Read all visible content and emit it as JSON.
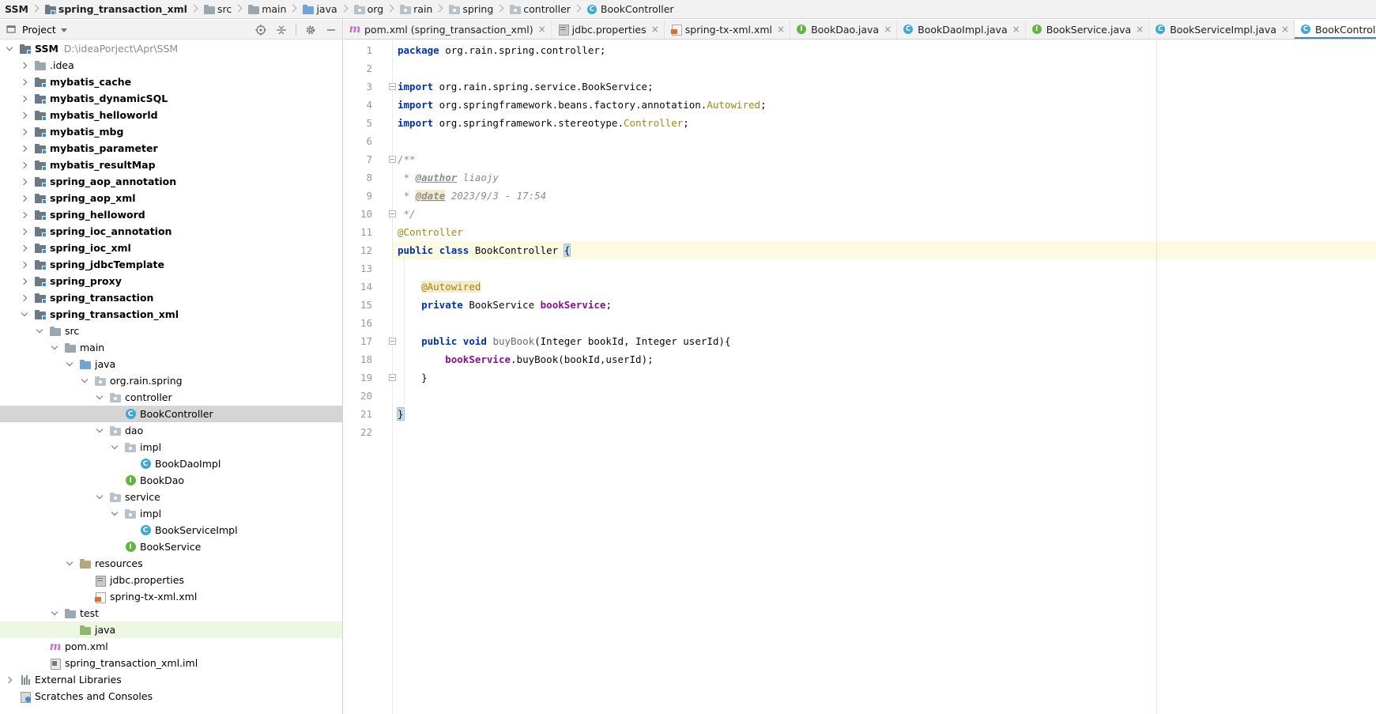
{
  "breadcrumb": [
    {
      "label": "SSM",
      "bold": true,
      "icon": "none"
    },
    {
      "label": "spring_transaction_xml",
      "bold": true,
      "icon": "module-folder-icon"
    },
    {
      "label": "src",
      "bold": false,
      "icon": "folder-icon"
    },
    {
      "label": "main",
      "bold": false,
      "icon": "folder-icon"
    },
    {
      "label": "java",
      "bold": false,
      "icon": "source-folder-icon"
    },
    {
      "label": "org",
      "bold": false,
      "icon": "package-icon"
    },
    {
      "label": "rain",
      "bold": false,
      "icon": "package-icon"
    },
    {
      "label": "spring",
      "bold": false,
      "icon": "package-icon"
    },
    {
      "label": "controller",
      "bold": false,
      "icon": "package-icon"
    },
    {
      "label": "BookController",
      "bold": false,
      "icon": "class-icon"
    }
  ],
  "project_panel": {
    "title": "Project",
    "tools": [
      "locate-icon",
      "collapse-all-icon",
      "gear-icon",
      "minimize-icon"
    ]
  },
  "tree": [
    {
      "level": 0,
      "arrow": "down",
      "icon": "module",
      "label": "SSM",
      "bold": true,
      "hint": "D:\\ideaPorject\\Apr\\SSM"
    },
    {
      "level": 1,
      "arrow": "right",
      "icon": "folder",
      "label": ".idea",
      "bold": false
    },
    {
      "level": 1,
      "arrow": "right",
      "icon": "module",
      "label": "mybatis_cache",
      "bold": true
    },
    {
      "level": 1,
      "arrow": "right",
      "icon": "module",
      "label": "mybatis_dynamicSQL",
      "bold": true
    },
    {
      "level": 1,
      "arrow": "right",
      "icon": "module",
      "label": "mybatis_helloworld",
      "bold": true
    },
    {
      "level": 1,
      "arrow": "right",
      "icon": "module",
      "label": "mybatis_mbg",
      "bold": true
    },
    {
      "level": 1,
      "arrow": "right",
      "icon": "module",
      "label": "mybatis_parameter",
      "bold": true
    },
    {
      "level": 1,
      "arrow": "right",
      "icon": "module",
      "label": "mybatis_resultMap",
      "bold": true
    },
    {
      "level": 1,
      "arrow": "right",
      "icon": "module",
      "label": "spring_aop_annotation",
      "bold": true
    },
    {
      "level": 1,
      "arrow": "right",
      "icon": "module",
      "label": "spring_aop_xml",
      "bold": true
    },
    {
      "level": 1,
      "arrow": "right",
      "icon": "module",
      "label": "spring_helloword",
      "bold": true
    },
    {
      "level": 1,
      "arrow": "right",
      "icon": "module",
      "label": "spring_ioc_annotation",
      "bold": true
    },
    {
      "level": 1,
      "arrow": "right",
      "icon": "module",
      "label": "spring_ioc_xml",
      "bold": true
    },
    {
      "level": 1,
      "arrow": "right",
      "icon": "module",
      "label": "spring_jdbcTemplate",
      "bold": true
    },
    {
      "level": 1,
      "arrow": "right",
      "icon": "module",
      "label": "spring_proxy",
      "bold": true
    },
    {
      "level": 1,
      "arrow": "right",
      "icon": "module",
      "label": "spring_transaction",
      "bold": true
    },
    {
      "level": 1,
      "arrow": "down",
      "icon": "module",
      "label": "spring_transaction_xml",
      "bold": true
    },
    {
      "level": 2,
      "arrow": "down",
      "icon": "folder",
      "label": "src",
      "bold": false
    },
    {
      "level": 3,
      "arrow": "down",
      "icon": "folder",
      "label": "main",
      "bold": false
    },
    {
      "level": 4,
      "arrow": "down",
      "icon": "java",
      "label": "java",
      "bold": false
    },
    {
      "level": 5,
      "arrow": "down",
      "icon": "pkg",
      "label": "org.rain.spring",
      "bold": false
    },
    {
      "level": 6,
      "arrow": "down",
      "icon": "pkg",
      "label": "controller",
      "bold": false
    },
    {
      "level": 7,
      "arrow": "none",
      "icon": "class",
      "label": "BookController",
      "bold": false,
      "state": "selected"
    },
    {
      "level": 6,
      "arrow": "down",
      "icon": "pkg",
      "label": "dao",
      "bold": false
    },
    {
      "level": 7,
      "arrow": "down",
      "icon": "pkg",
      "label": "impl",
      "bold": false
    },
    {
      "level": 8,
      "arrow": "none",
      "icon": "class",
      "label": "BookDaoImpl",
      "bold": false
    },
    {
      "level": 7,
      "arrow": "none",
      "icon": "iface",
      "label": "BookDao",
      "bold": false
    },
    {
      "level": 6,
      "arrow": "down",
      "icon": "pkg",
      "label": "service",
      "bold": false
    },
    {
      "level": 7,
      "arrow": "down",
      "icon": "pkg",
      "label": "impl",
      "bold": false
    },
    {
      "level": 8,
      "arrow": "none",
      "icon": "class",
      "label": "BookServiceImpl",
      "bold": false
    },
    {
      "level": 7,
      "arrow": "none",
      "icon": "iface",
      "label": "BookService",
      "bold": false
    },
    {
      "level": 4,
      "arrow": "down",
      "icon": "res",
      "label": "resources",
      "bold": false
    },
    {
      "level": 5,
      "arrow": "none",
      "icon": "props",
      "label": "jdbc.properties",
      "bold": false
    },
    {
      "level": 5,
      "arrow": "none",
      "icon": "xml",
      "label": "spring-tx-xml.xml",
      "bold": false
    },
    {
      "level": 3,
      "arrow": "down",
      "icon": "folder",
      "label": "test",
      "bold": false
    },
    {
      "level": 4,
      "arrow": "none",
      "icon": "test",
      "label": "java",
      "bold": false,
      "state": "highlight"
    },
    {
      "level": 2,
      "arrow": "none",
      "icon": "maven",
      "label": "pom.xml",
      "bold": false
    },
    {
      "level": 2,
      "arrow": "none",
      "icon": "iml",
      "label": "spring_transaction_xml.iml",
      "bold": false
    },
    {
      "level": 0,
      "arrow": "right",
      "icon": "libs",
      "label": "External Libraries",
      "bold": false
    },
    {
      "level": 0,
      "arrow": "none",
      "icon": "scratch",
      "label": "Scratches and Consoles",
      "bold": false
    }
  ],
  "tabs": [
    {
      "label": "pom.xml (spring_transaction_xml)",
      "icon": "maven",
      "active": false
    },
    {
      "label": "jdbc.properties",
      "icon": "props",
      "active": false
    },
    {
      "label": "spring-tx-xml.xml",
      "icon": "xml",
      "active": false
    },
    {
      "label": "BookDao.java",
      "icon": "iface",
      "active": false
    },
    {
      "label": "BookDaoImpl.java",
      "icon": "class",
      "active": false
    },
    {
      "label": "BookService.java",
      "icon": "iface",
      "active": false
    },
    {
      "label": "BookServiceImpl.java",
      "icon": "class",
      "active": false
    },
    {
      "label": "BookController.java",
      "icon": "class",
      "active": true
    }
  ],
  "editor": {
    "current_line": 12,
    "line_numbers": [
      "1",
      "2",
      "3",
      "4",
      "5",
      "6",
      "7",
      "8",
      "9",
      "10",
      "11",
      "12",
      "13",
      "14",
      "15",
      "16",
      "17",
      "18",
      "19",
      "20",
      "21",
      "22"
    ],
    "lines": [
      [
        [
          "kw",
          "package"
        ],
        [
          "plain",
          " org.rain.spring.controller;"
        ]
      ],
      [],
      [
        [
          "kw",
          "import"
        ],
        [
          "plain",
          " org.rain.spring.service.BookService;"
        ]
      ],
      [
        [
          "kw",
          "import"
        ],
        [
          "plain",
          " org.springframework.beans.factory.annotation."
        ],
        [
          "ann",
          "Autowired"
        ],
        [
          "plain",
          ";"
        ]
      ],
      [
        [
          "kw",
          "import"
        ],
        [
          "plain",
          " org.springframework.stereotype."
        ],
        [
          "ann",
          "Controller"
        ],
        [
          "plain",
          ";"
        ]
      ],
      [],
      [
        [
          "cmt",
          "/**"
        ]
      ],
      [
        [
          "cmt",
          " * "
        ],
        [
          "doc-tag",
          "@author"
        ],
        [
          "cmt",
          " liaojy"
        ]
      ],
      [
        [
          "cmt",
          " * "
        ],
        [
          "doc-tag-hl",
          "@date"
        ],
        [
          "cmt",
          " 2023/9/3 - 17:54"
        ]
      ],
      [
        [
          "cmt",
          " */"
        ]
      ],
      [
        [
          "ann",
          "@Controller"
        ]
      ],
      [
        [
          "kw",
          "public"
        ],
        [
          "plain",
          " "
        ],
        [
          "kw",
          "class"
        ],
        [
          "plain",
          " BookController "
        ],
        [
          "brace-hl",
          "{"
        ]
      ],
      [],
      [
        [
          "plain",
          "    "
        ],
        [
          "ann-hl",
          "@Autowired"
        ]
      ],
      [
        [
          "plain",
          "    "
        ],
        [
          "kw",
          "private"
        ],
        [
          "plain",
          " BookService "
        ],
        [
          "field",
          "bookService"
        ],
        [
          "plain",
          ";"
        ]
      ],
      [],
      [
        [
          "plain",
          "    "
        ],
        [
          "kw",
          "public"
        ],
        [
          "plain",
          " "
        ],
        [
          "kw",
          "void"
        ],
        [
          "plain",
          " "
        ],
        [
          "method",
          "buyBook"
        ],
        [
          "plain",
          "(Integer bookId, Integer userId){"
        ]
      ],
      [
        [
          "plain",
          "        "
        ],
        [
          "field",
          "bookService"
        ],
        [
          "plain",
          ".buyBook(bookId,userId);"
        ]
      ],
      [
        [
          "plain",
          "    }"
        ]
      ],
      [],
      [
        [
          "brace-hl",
          "}"
        ]
      ],
      []
    ]
  }
}
